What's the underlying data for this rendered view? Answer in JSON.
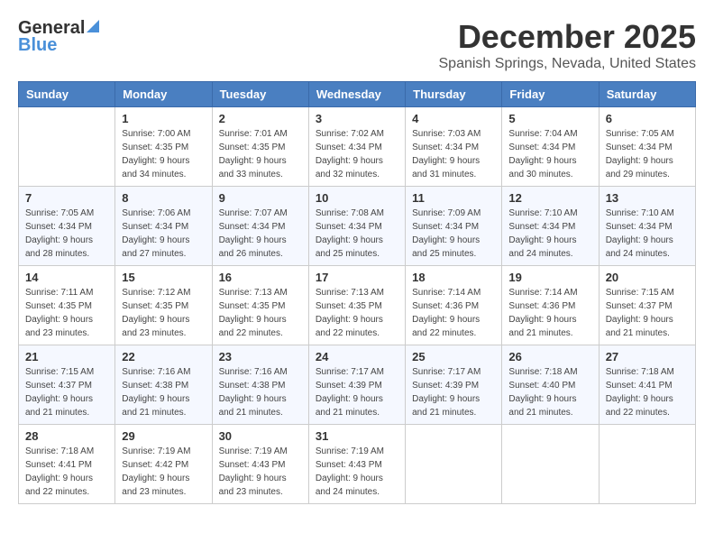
{
  "header": {
    "logo_general": "General",
    "logo_blue": "Blue",
    "month": "December 2025",
    "location": "Spanish Springs, Nevada, United States"
  },
  "days_of_week": [
    "Sunday",
    "Monday",
    "Tuesday",
    "Wednesday",
    "Thursday",
    "Friday",
    "Saturday"
  ],
  "weeks": [
    [
      {
        "day": "",
        "sunrise": "",
        "sunset": "",
        "daylight": ""
      },
      {
        "day": "1",
        "sunrise": "Sunrise: 7:00 AM",
        "sunset": "Sunset: 4:35 PM",
        "daylight": "Daylight: 9 hours and 34 minutes."
      },
      {
        "day": "2",
        "sunrise": "Sunrise: 7:01 AM",
        "sunset": "Sunset: 4:35 PM",
        "daylight": "Daylight: 9 hours and 33 minutes."
      },
      {
        "day": "3",
        "sunrise": "Sunrise: 7:02 AM",
        "sunset": "Sunset: 4:34 PM",
        "daylight": "Daylight: 9 hours and 32 minutes."
      },
      {
        "day": "4",
        "sunrise": "Sunrise: 7:03 AM",
        "sunset": "Sunset: 4:34 PM",
        "daylight": "Daylight: 9 hours and 31 minutes."
      },
      {
        "day": "5",
        "sunrise": "Sunrise: 7:04 AM",
        "sunset": "Sunset: 4:34 PM",
        "daylight": "Daylight: 9 hours and 30 minutes."
      },
      {
        "day": "6",
        "sunrise": "Sunrise: 7:05 AM",
        "sunset": "Sunset: 4:34 PM",
        "daylight": "Daylight: 9 hours and 29 minutes."
      }
    ],
    [
      {
        "day": "7",
        "sunrise": "Sunrise: 7:05 AM",
        "sunset": "Sunset: 4:34 PM",
        "daylight": "Daylight: 9 hours and 28 minutes."
      },
      {
        "day": "8",
        "sunrise": "Sunrise: 7:06 AM",
        "sunset": "Sunset: 4:34 PM",
        "daylight": "Daylight: 9 hours and 27 minutes."
      },
      {
        "day": "9",
        "sunrise": "Sunrise: 7:07 AM",
        "sunset": "Sunset: 4:34 PM",
        "daylight": "Daylight: 9 hours and 26 minutes."
      },
      {
        "day": "10",
        "sunrise": "Sunrise: 7:08 AM",
        "sunset": "Sunset: 4:34 PM",
        "daylight": "Daylight: 9 hours and 25 minutes."
      },
      {
        "day": "11",
        "sunrise": "Sunrise: 7:09 AM",
        "sunset": "Sunset: 4:34 PM",
        "daylight": "Daylight: 9 hours and 25 minutes."
      },
      {
        "day": "12",
        "sunrise": "Sunrise: 7:10 AM",
        "sunset": "Sunset: 4:34 PM",
        "daylight": "Daylight: 9 hours and 24 minutes."
      },
      {
        "day": "13",
        "sunrise": "Sunrise: 7:10 AM",
        "sunset": "Sunset: 4:34 PM",
        "daylight": "Daylight: 9 hours and 24 minutes."
      }
    ],
    [
      {
        "day": "14",
        "sunrise": "Sunrise: 7:11 AM",
        "sunset": "Sunset: 4:35 PM",
        "daylight": "Daylight: 9 hours and 23 minutes."
      },
      {
        "day": "15",
        "sunrise": "Sunrise: 7:12 AM",
        "sunset": "Sunset: 4:35 PM",
        "daylight": "Daylight: 9 hours and 23 minutes."
      },
      {
        "day": "16",
        "sunrise": "Sunrise: 7:13 AM",
        "sunset": "Sunset: 4:35 PM",
        "daylight": "Daylight: 9 hours and 22 minutes."
      },
      {
        "day": "17",
        "sunrise": "Sunrise: 7:13 AM",
        "sunset": "Sunset: 4:35 PM",
        "daylight": "Daylight: 9 hours and 22 minutes."
      },
      {
        "day": "18",
        "sunrise": "Sunrise: 7:14 AM",
        "sunset": "Sunset: 4:36 PM",
        "daylight": "Daylight: 9 hours and 22 minutes."
      },
      {
        "day": "19",
        "sunrise": "Sunrise: 7:14 AM",
        "sunset": "Sunset: 4:36 PM",
        "daylight": "Daylight: 9 hours and 21 minutes."
      },
      {
        "day": "20",
        "sunrise": "Sunrise: 7:15 AM",
        "sunset": "Sunset: 4:37 PM",
        "daylight": "Daylight: 9 hours and 21 minutes."
      }
    ],
    [
      {
        "day": "21",
        "sunrise": "Sunrise: 7:15 AM",
        "sunset": "Sunset: 4:37 PM",
        "daylight": "Daylight: 9 hours and 21 minutes."
      },
      {
        "day": "22",
        "sunrise": "Sunrise: 7:16 AM",
        "sunset": "Sunset: 4:38 PM",
        "daylight": "Daylight: 9 hours and 21 minutes."
      },
      {
        "day": "23",
        "sunrise": "Sunrise: 7:16 AM",
        "sunset": "Sunset: 4:38 PM",
        "daylight": "Daylight: 9 hours and 21 minutes."
      },
      {
        "day": "24",
        "sunrise": "Sunrise: 7:17 AM",
        "sunset": "Sunset: 4:39 PM",
        "daylight": "Daylight: 9 hours and 21 minutes."
      },
      {
        "day": "25",
        "sunrise": "Sunrise: 7:17 AM",
        "sunset": "Sunset: 4:39 PM",
        "daylight": "Daylight: 9 hours and 21 minutes."
      },
      {
        "day": "26",
        "sunrise": "Sunrise: 7:18 AM",
        "sunset": "Sunset: 4:40 PM",
        "daylight": "Daylight: 9 hours and 21 minutes."
      },
      {
        "day": "27",
        "sunrise": "Sunrise: 7:18 AM",
        "sunset": "Sunset: 4:41 PM",
        "daylight": "Daylight: 9 hours and 22 minutes."
      }
    ],
    [
      {
        "day": "28",
        "sunrise": "Sunrise: 7:18 AM",
        "sunset": "Sunset: 4:41 PM",
        "daylight": "Daylight: 9 hours and 22 minutes."
      },
      {
        "day": "29",
        "sunrise": "Sunrise: 7:19 AM",
        "sunset": "Sunset: 4:42 PM",
        "daylight": "Daylight: 9 hours and 23 minutes."
      },
      {
        "day": "30",
        "sunrise": "Sunrise: 7:19 AM",
        "sunset": "Sunset: 4:43 PM",
        "daylight": "Daylight: 9 hours and 23 minutes."
      },
      {
        "day": "31",
        "sunrise": "Sunrise: 7:19 AM",
        "sunset": "Sunset: 4:43 PM",
        "daylight": "Daylight: 9 hours and 24 minutes."
      },
      {
        "day": "",
        "sunrise": "",
        "sunset": "",
        "daylight": ""
      },
      {
        "day": "",
        "sunrise": "",
        "sunset": "",
        "daylight": ""
      },
      {
        "day": "",
        "sunrise": "",
        "sunset": "",
        "daylight": ""
      }
    ]
  ]
}
